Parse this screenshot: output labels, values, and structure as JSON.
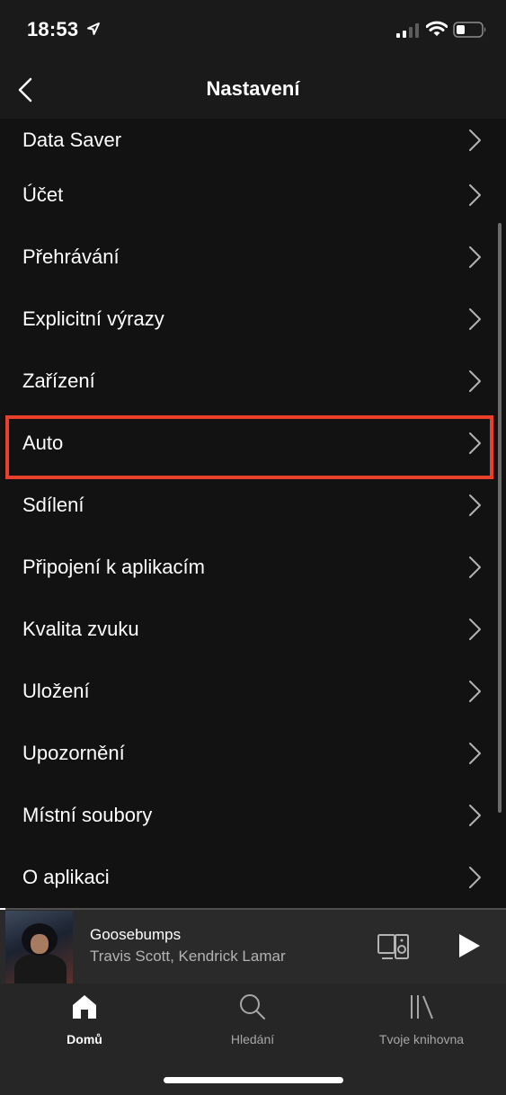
{
  "status_bar": {
    "time": "18:53",
    "icons": [
      "location-arrow-icon",
      "signal-icon",
      "wifi-icon",
      "battery-icon"
    ]
  },
  "header": {
    "title": "Nastavení",
    "back_icon": "back-chevron-icon"
  },
  "settings": {
    "items": [
      {
        "label": "Data Saver"
      },
      {
        "label": "Účet"
      },
      {
        "label": "Přehrávání"
      },
      {
        "label": "Explicitní výrazy"
      },
      {
        "label": "Zařízení"
      },
      {
        "label": "Auto"
      },
      {
        "label": "Sdílení"
      },
      {
        "label": "Připojení k aplikacím"
      },
      {
        "label": "Kvalita zvuku"
      },
      {
        "label": "Uložení"
      },
      {
        "label": "Upozornění"
      },
      {
        "label": "Místní soubory"
      },
      {
        "label": "O aplikaci"
      }
    ],
    "highlighted_item": "Auto",
    "highlight_color": "#e8402a"
  },
  "now_playing": {
    "title": "Goosebumps",
    "artist": "Travis Scott, Kendrick Lamar",
    "progress": 0.01
  },
  "tabs": [
    {
      "label": "Domů",
      "icon": "home-icon",
      "active": true
    },
    {
      "label": "Hledání",
      "icon": "search-icon",
      "active": false
    },
    {
      "label": "Tvoje knihovna",
      "icon": "library-icon",
      "active": false
    }
  ],
  "colors": {
    "background": "#121212",
    "header_background": "#1a1a1a",
    "player_background": "#2a2a2a",
    "tabbar_background": "#262626",
    "text_primary": "#ffffff",
    "text_secondary": "#b3b3b3"
  }
}
